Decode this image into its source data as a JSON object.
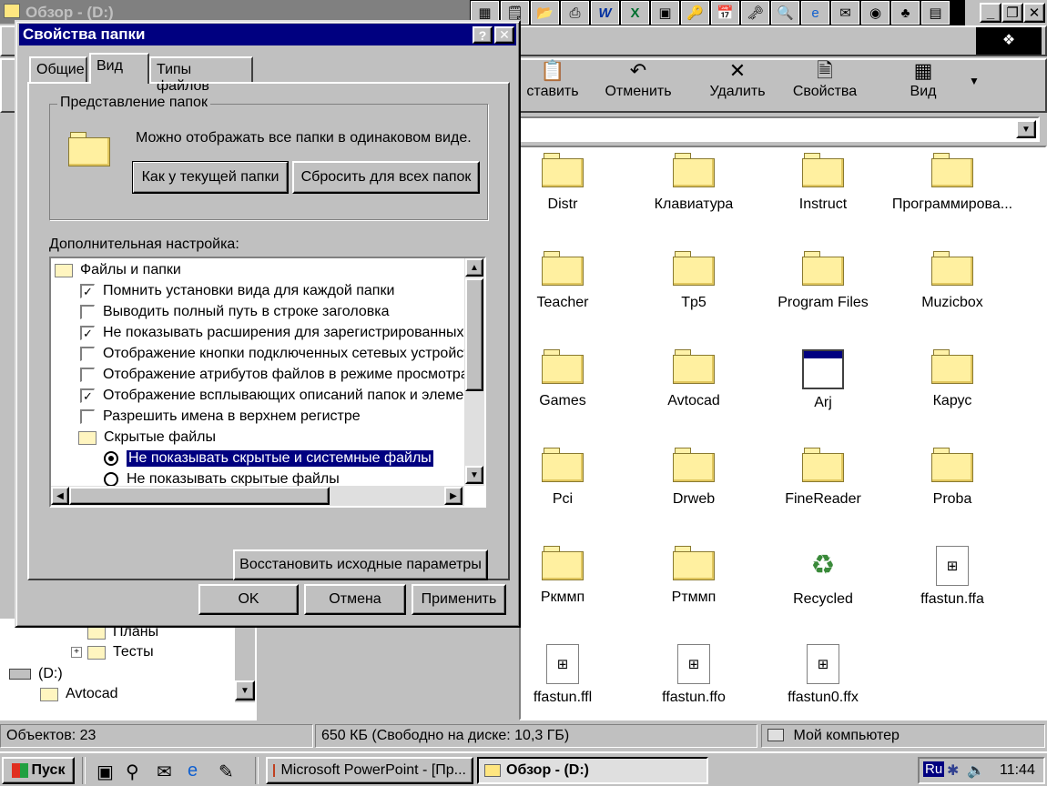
{
  "explorer": {
    "title": "Обзор - (D:)",
    "toolbar": {
      "paste": "ставить",
      "undo": "Отменить",
      "delete": "Удалить",
      "properties": "Свойства",
      "view": "Вид"
    },
    "files": [
      {
        "name": "Distr",
        "kind": "folder"
      },
      {
        "name": "Клавиатура",
        "kind": "folder"
      },
      {
        "name": "Instruct",
        "kind": "folder"
      },
      {
        "name": "Программирова...",
        "kind": "folder"
      },
      {
        "name": "Teacher",
        "kind": "folder"
      },
      {
        "name": "Tp5",
        "kind": "folder"
      },
      {
        "name": "Program Files",
        "kind": "folder"
      },
      {
        "name": "Muzicbox",
        "kind": "folder"
      },
      {
        "name": "Games",
        "kind": "folder"
      },
      {
        "name": "Avtocad",
        "kind": "folder"
      },
      {
        "name": "Arj",
        "kind": "app"
      },
      {
        "name": "Карус",
        "kind": "folder"
      },
      {
        "name": "Pci",
        "kind": "folder"
      },
      {
        "name": "Drweb",
        "kind": "folder"
      },
      {
        "name": "FineReader",
        "kind": "folder"
      },
      {
        "name": "Proba",
        "kind": "folder"
      },
      {
        "name": "Ркммп",
        "kind": "folder"
      },
      {
        "name": "Ртммп",
        "kind": "folder"
      },
      {
        "name": "Recycled",
        "kind": "recycle"
      },
      {
        "name": "ffastun.ffa",
        "kind": "doc"
      },
      {
        "name": "ffastun.ffl",
        "kind": "doc"
      },
      {
        "name": "ffastun.ffo",
        "kind": "doc"
      },
      {
        "name": "ffastun0.ffx",
        "kind": "doc"
      }
    ],
    "tree": {
      "plans": "Планы",
      "tests": "Тесты",
      "drive": "(D:)",
      "avtocad": "Avtocad"
    },
    "status": {
      "objects": "Объектов: 23",
      "size": "650 КБ (Свободно на диске: 10,3 ГБ)",
      "location": "Мой компьютер"
    }
  },
  "dialog": {
    "title": "Свойства папки",
    "help_btn": "?",
    "close_btn": "✕",
    "tabs": [
      "Общие",
      "Вид",
      "Типы файлов"
    ],
    "group_label": "Представление папок",
    "group_text": "Можно отображать все папки в одинаковом виде.",
    "like_current": "Как у текущей папки",
    "reset_all": "Сбросить для всех папок",
    "advanced_label": "Дополнительная настройка:",
    "tree": [
      {
        "type": "folder",
        "label": "Файлы и папки"
      },
      {
        "type": "check",
        "checked": true,
        "label": "Помнить установки вида для каждой папки"
      },
      {
        "type": "check",
        "checked": false,
        "label": "Выводить полный путь в строке заголовка"
      },
      {
        "type": "check",
        "checked": true,
        "label": "Не показывать расширения для зарегистрированных"
      },
      {
        "type": "check",
        "checked": false,
        "label": "Отображение кнопки подключенных сетевых устройст"
      },
      {
        "type": "check",
        "checked": false,
        "label": "Отображение атрибутов файлов в режиме просмотра"
      },
      {
        "type": "check",
        "checked": true,
        "label": "Отображение всплывающих описаний папок и элемен"
      },
      {
        "type": "check",
        "checked": false,
        "label": "Разрешить имена в верхнем регистре"
      },
      {
        "type": "folder",
        "label": "Скрытые файлы"
      },
      {
        "type": "radio",
        "checked": true,
        "label": "Не показывать скрытые и системные файлы"
      },
      {
        "type": "radio",
        "checked": false,
        "label": "Не показывать скрытые файлы"
      }
    ],
    "restore_defaults": "Восстановить исходные параметры",
    "ok": "OK",
    "cancel": "Отмена",
    "apply": "Применить"
  },
  "taskbar": {
    "start": "Пуск",
    "task1": "Microsoft PowerPoint - [Пр...",
    "task2": "Обзор - (D:)",
    "lang": "Ru",
    "time": "11:44"
  },
  "colors": {
    "titlebar_active": "#000080",
    "face": "#c0c0c0",
    "folder_yellow": "#fff0a0"
  }
}
